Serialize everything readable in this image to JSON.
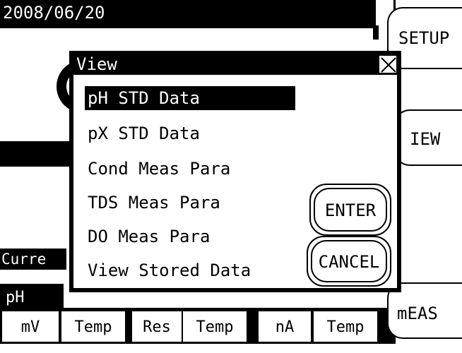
{
  "status": {
    "date": "2008/06/20"
  },
  "side_buttons": {
    "setup": "SETUP",
    "view": "IEW",
    "meas": "mEAS"
  },
  "main": {
    "current_label": "Curre",
    "ph_tab": "pH"
  },
  "bottom_row": [
    "mV",
    "Temp",
    "Res",
    "Temp",
    "nA",
    "Temp"
  ],
  "dialog": {
    "title": "View",
    "items": [
      "pH STD Data",
      "pX STD Data",
      "Cond Meas Para",
      "TDS Meas Para",
      "DO Meas Para",
      "View Stored Data"
    ],
    "selected_index": 0,
    "enter_label": "ENTER",
    "cancel_label": "CANCEL"
  }
}
